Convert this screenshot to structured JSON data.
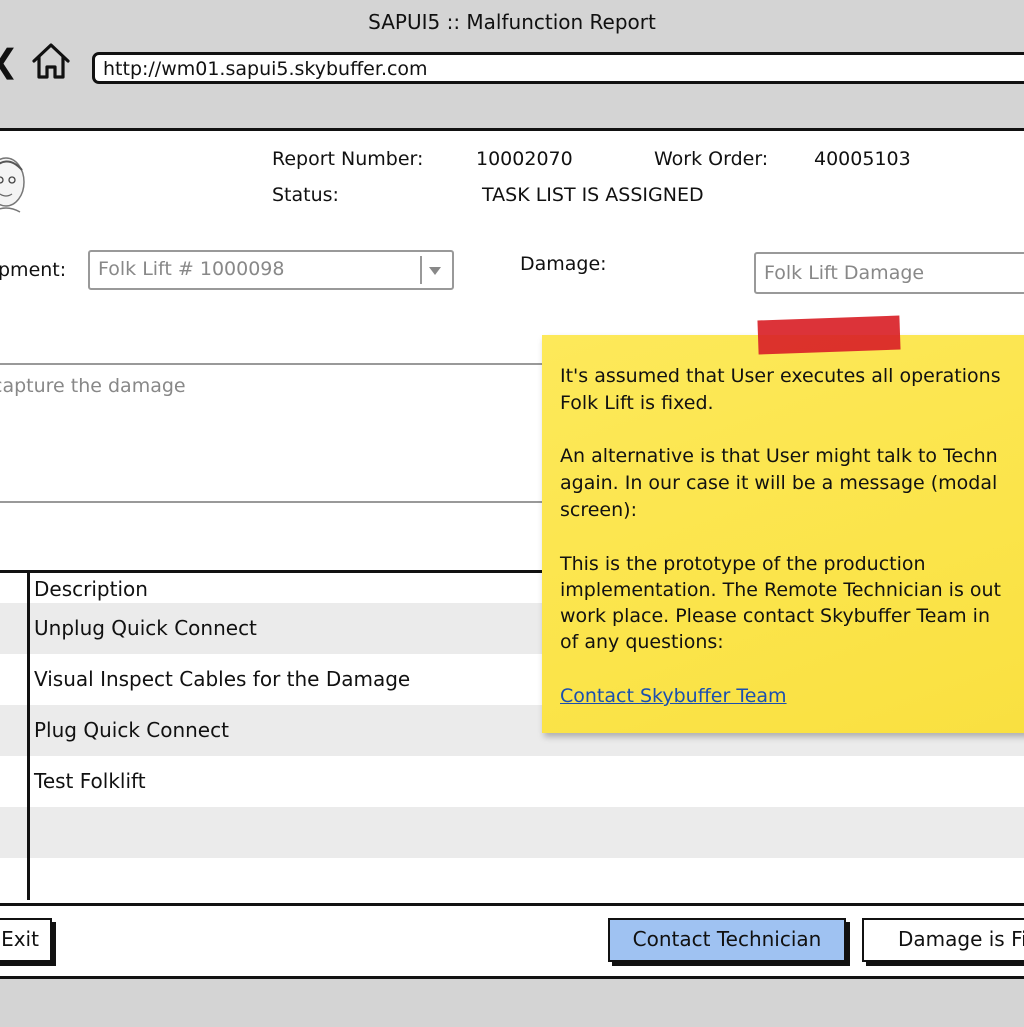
{
  "window": {
    "title": "SAPUI5 :: Malfunction Report"
  },
  "browser": {
    "back_glyph": "❮",
    "url": "http://wm01.sapui5.skybuffer.com"
  },
  "report": {
    "number_label": "Report Number:",
    "number_value": "10002070",
    "work_order_label": "Work Order:",
    "work_order_value": "40005103",
    "status_label": "Status:",
    "status_value": "TASK LIST IS ASSIGNED"
  },
  "form": {
    "equipment_label": "pment:",
    "equipment_value": "Folk Lift # 1000098",
    "damage_label": "Damage:",
    "damage_value": "Folk Lift Damage",
    "capture_placeholder": "capture the damage"
  },
  "table": {
    "header": "Description",
    "rows": [
      "Unplug Quick Connect",
      "Visual Inspect Cables for the Damage",
      "Plug Quick Connect",
      "Test Folklift"
    ]
  },
  "note": {
    "p1_line1": "It's assumed that User executes all operations",
    "p1_line2": "Folk Lift is fixed.",
    "p2_line1": "An alternative is that User might talk to Techn",
    "p2_line2": "again. In our case it will be a message (modal",
    "p2_line3": "screen):",
    "p3_line1": "This is the prototype of the production",
    "p3_line2": "implementation. The Remote Technician is out",
    "p3_line3": "work place. Please contact Skybuffer Team in",
    "p3_line4": "of any questions:",
    "link_text": "Contact Skybuffer Team"
  },
  "actions": {
    "exit_label": "Exit",
    "contact_technician_label": "Contact Technician",
    "damage_fixed_label": "Damage is Fi"
  },
  "colors": {
    "note_yellow": "#fce94f",
    "tape_red": "#d92228",
    "primary_button_blue": "#9fc2f2",
    "link_blue": "#1a4fb0"
  }
}
